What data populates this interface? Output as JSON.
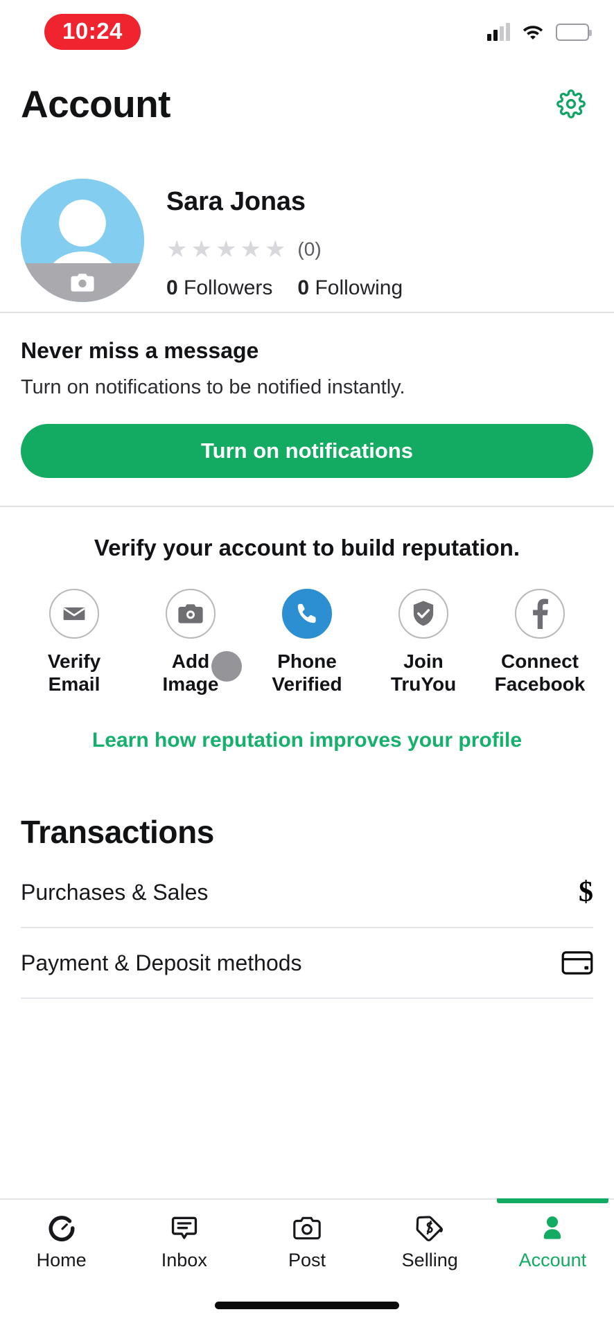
{
  "status_bar": {
    "time": "10:24",
    "signal_icon": "cellular-signal-icon",
    "wifi_icon": "wifi-icon",
    "battery_icon": "battery-icon",
    "battery_color": "#FFCC00",
    "time_pill_color": "#F0242F"
  },
  "header": {
    "title": "Account",
    "settings_icon": "gear-icon",
    "accent_color": "#13AB62"
  },
  "profile": {
    "name": "Sara Jonas",
    "avatar_icon": "default-avatar-icon",
    "avatar_camera_icon": "camera-icon",
    "avatar_bg_color": "#82CDF0",
    "stars": [
      "★",
      "★",
      "★",
      "★",
      "★"
    ],
    "star_color": "#D8D8DC",
    "rating_count": "(0)",
    "followers_count": "0",
    "followers_label": "Followers",
    "following_count": "0",
    "following_label": "Following"
  },
  "notifications": {
    "title": "Never miss a message",
    "subtitle": "Turn on notifications to be notified instantly.",
    "button_label": "Turn on notifications",
    "button_color": "#13AB62"
  },
  "verify": {
    "heading": "Verify your account to build reputation.",
    "items": [
      {
        "icon": "envelope-icon",
        "label": "Verify\nEmail",
        "label_line1": "Verify",
        "label_line2": "Email",
        "active": false
      },
      {
        "icon": "camera-icon",
        "label": "Add\nImage",
        "label_line1": "Add",
        "label_line2": "Image",
        "active": false
      },
      {
        "icon": "phone-icon",
        "label": "Phone\nVerified",
        "label_line1": "Phone",
        "label_line2": "Verified",
        "active": true,
        "active_color": "#2C8FD1"
      },
      {
        "icon": "shield-check-icon",
        "label": "Join\nTruYou",
        "label_line1": "Join",
        "label_line2": "TruYou",
        "active": false
      },
      {
        "icon": "facebook-icon",
        "label": "Connect\nFacebook",
        "label_line1": "Connect",
        "label_line2": "Facebook",
        "active": false
      }
    ],
    "learn_link": "Learn how reputation improves your profile",
    "learn_link_color": "#15B06B"
  },
  "transactions": {
    "title": "Transactions",
    "rows": [
      {
        "label": "Purchases & Sales",
        "icon": "dollar-sign-icon",
        "glyph": "$"
      },
      {
        "label": "Payment & Deposit methods",
        "icon": "credit-card-icon"
      }
    ]
  },
  "bottom_nav": {
    "items": [
      {
        "label": "Home",
        "icon": "home-circle-icon",
        "active": false
      },
      {
        "label": "Inbox",
        "icon": "chat-bubble-icon",
        "active": false
      },
      {
        "label": "Post",
        "icon": "camera-icon",
        "active": false
      },
      {
        "label": "Selling",
        "icon": "price-tag-dollar-icon",
        "active": false
      },
      {
        "label": "Account",
        "icon": "person-icon",
        "active": true
      }
    ],
    "active_color": "#13AB62"
  }
}
